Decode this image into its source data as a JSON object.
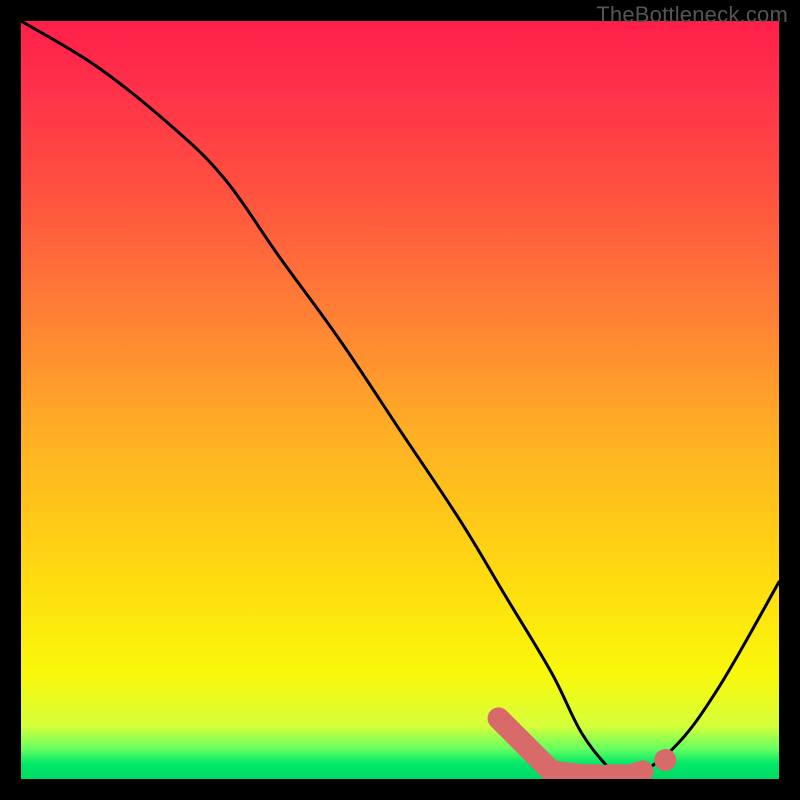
{
  "watermark": "TheBottleneck.com",
  "colors": {
    "page_bg": "#000000",
    "curve_stroke": "#000000",
    "accent_stroke": "#d96a6a",
    "gradient_top": "#ff1f4a",
    "gradient_bottom": "#00da66"
  },
  "chart_data": {
    "type": "line",
    "title": "",
    "xlabel": "",
    "ylabel": "",
    "xlim": [
      0,
      100
    ],
    "ylim": [
      0,
      100
    ],
    "grid": false,
    "legend": false,
    "series": [
      {
        "name": "bottleneck-curve",
        "x": [
          0,
          10,
          20,
          27,
          34,
          42,
          50,
          58,
          64,
          70,
          74,
          78,
          80,
          86,
          92,
          100
        ],
        "values": [
          100,
          94,
          86,
          79,
          69,
          58,
          46,
          34,
          24,
          14,
          6,
          1,
          0,
          4,
          12,
          26
        ]
      }
    ],
    "accent_segments": [
      {
        "name": "highlight-valley-left",
        "x": [
          63,
          67,
          70,
          74,
          76
        ],
        "values": [
          8,
          4,
          1,
          0.5,
          0.5
        ]
      },
      {
        "name": "highlight-dash-1",
        "x": [
          77.5,
          79.5
        ],
        "values": [
          0.5,
          0.5
        ]
      },
      {
        "name": "highlight-dash-2",
        "x": [
          80.5,
          82
        ],
        "values": [
          0.5,
          1
        ]
      }
    ],
    "accent_points": [
      {
        "name": "highlight-dot",
        "x": 85,
        "y": 2.5
      }
    ]
  }
}
